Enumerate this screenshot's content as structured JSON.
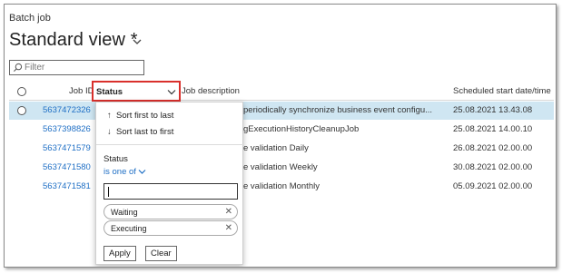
{
  "page": {
    "caption": "Batch job",
    "view_title": "Standard view *"
  },
  "filter": {
    "placeholder": "Filter"
  },
  "grid": {
    "columns": {
      "job_id": "Job ID",
      "description": "Job description",
      "scheduled": "Scheduled start date/time"
    },
    "rows": [
      {
        "job_id": "5637472326",
        "description": "periodically synchronize business event configu...",
        "scheduled": "25.08.2021 13.43.08",
        "selected": true
      },
      {
        "job_id": "5637398826",
        "description": "gExecutionHistoryCleanupJob",
        "scheduled": "25.08.2021 14.00.10",
        "selected": false
      },
      {
        "job_id": "5637471579",
        "description": "e validation Daily",
        "scheduled": "26.08.2021 02.00.00",
        "selected": false
      },
      {
        "job_id": "5637471580",
        "description": "e validation Weekly",
        "scheduled": "30.08.2021 02.00.00",
        "selected": false
      },
      {
        "job_id": "5637471581",
        "description": "e validation Monthly",
        "scheduled": "05.09.2021 02.00.00",
        "selected": false
      }
    ]
  },
  "status_header": {
    "label": "Status"
  },
  "dropdown": {
    "sort_first_to_last": "Sort first to last",
    "sort_last_to_first": "Sort last to first",
    "filter_label": "Status",
    "operator": "is one of",
    "input_value": "",
    "chips": [
      {
        "label": "Waiting"
      },
      {
        "label": "Executing"
      }
    ],
    "apply_label": "Apply",
    "clear_label": "Clear"
  },
  "colors": {
    "link": "#1f6fc5",
    "selected_row": "#cfe6f2",
    "highlight_border": "#d9302c"
  }
}
